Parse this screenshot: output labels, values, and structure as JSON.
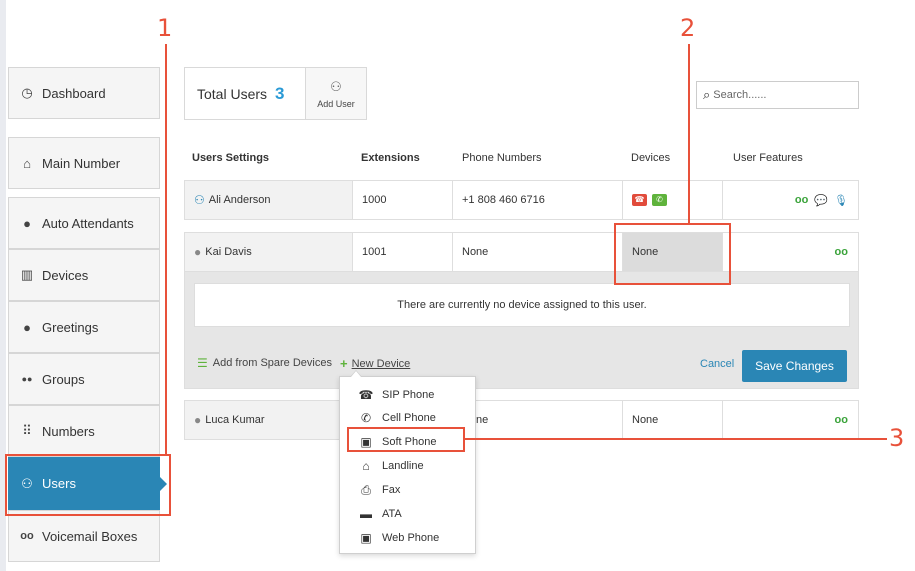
{
  "sidebar": {
    "items": [
      {
        "label": "Dashboard",
        "icon": "gauge-icon",
        "glyph": "◷"
      },
      {
        "label": "Main Number",
        "icon": "home-icon",
        "glyph": "⌂"
      },
      {
        "label": "Auto Attendants",
        "icon": "speech-head-icon",
        "glyph": "●"
      },
      {
        "label": "Devices",
        "icon": "devices-icon",
        "glyph": "▥"
      },
      {
        "label": "Greetings",
        "icon": "speech-head-icon",
        "glyph": "●"
      },
      {
        "label": "Groups",
        "icon": "group-icon",
        "glyph": "●●"
      },
      {
        "label": "Numbers",
        "icon": "keypad-icon",
        "glyph": "⠿"
      },
      {
        "label": "Users",
        "icon": "users-icon",
        "glyph": "⚇"
      },
      {
        "label": "Voicemail Boxes",
        "icon": "voicemail-icon",
        "glyph": "oo"
      }
    ]
  },
  "summary": {
    "total_label": "Total Users",
    "total_count": "3",
    "add_user_label": "Add User"
  },
  "search": {
    "placeholder": "Search......"
  },
  "table": {
    "headers": [
      "Users Settings",
      "Extensions",
      "Phone Numbers",
      "Devices",
      "User Features"
    ],
    "rows": [
      {
        "name": "Ali Anderson",
        "extension": "1000",
        "phone": "+1 808 460 6716",
        "devices": ""
      },
      {
        "name": "Kai Davis",
        "extension": "1001",
        "phone": "None",
        "devices": "None"
      },
      {
        "name": "Luca Kumar",
        "extension": "",
        "phone": "None",
        "devices": "None"
      }
    ]
  },
  "panel": {
    "message": "There are currently no device assigned to this user.",
    "add_spare_label": "Add from Spare Devices",
    "new_device_label": "New Device",
    "cancel_label": "Cancel",
    "save_label": "Save Changes"
  },
  "device_menu": {
    "items": [
      {
        "label": "SIP Phone",
        "icon": "sip-phone-icon",
        "glyph": "☎"
      },
      {
        "label": "Cell Phone",
        "icon": "cell-phone-icon",
        "glyph": "✆"
      },
      {
        "label": "Soft Phone",
        "icon": "soft-phone-icon",
        "glyph": "▣"
      },
      {
        "label": "Landline",
        "icon": "home-icon",
        "glyph": "⌂"
      },
      {
        "label": "Fax",
        "icon": "fax-icon",
        "glyph": "⎙"
      },
      {
        "label": "ATA",
        "icon": "ata-icon",
        "glyph": "▬"
      },
      {
        "label": "Web Phone",
        "icon": "web-phone-icon",
        "glyph": "▣"
      }
    ]
  },
  "annotations": [
    "1",
    "2",
    "3"
  ],
  "colors": {
    "accent": "#2a86b5",
    "annotation": "#e8513a",
    "success": "#5fb33c",
    "device_red": "#e14b3b"
  }
}
